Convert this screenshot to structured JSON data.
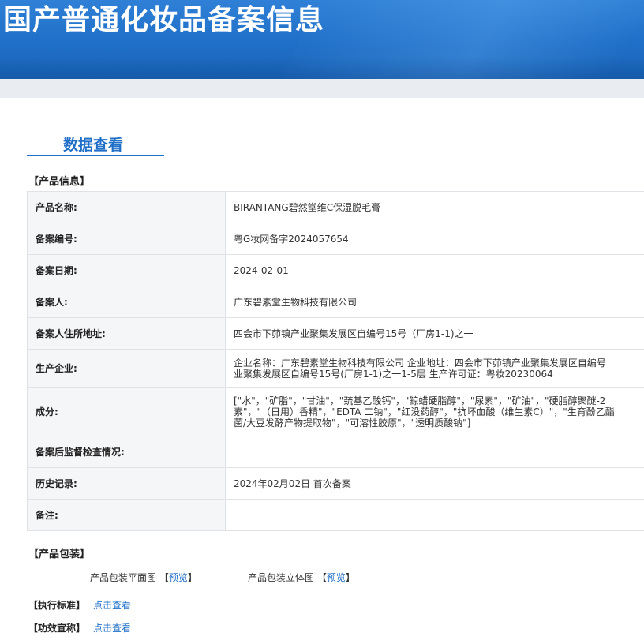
{
  "banner": {
    "title": "国产普通化妆品备案信息"
  },
  "tab": {
    "label": "数据查看"
  },
  "product_info": {
    "heading": "【产品信息】",
    "rows": [
      {
        "label": "产品名称:",
        "value": "BIRANTANG碧然堂维C保湿脱毛膏"
      },
      {
        "label": "备案编号:",
        "value": "粤G妆网备字2024057654"
      },
      {
        "label": "备案日期:",
        "value": "2024-02-01"
      },
      {
        "label": "备案人:",
        "value": "广东碧素堂生物科技有限公司"
      },
      {
        "label": "备案人住所地址:",
        "value": "四会市下茆镇产业聚集发展区自编号15号（厂房1-1)之一"
      },
      {
        "label": "生产企业:",
        "value_lines": [
          "企业名称：广东碧素堂生物科技有限公司 企业地址：四会市下茆镇产业聚集发展区自编号",
          "业聚集发展区自编号15号(厂房1-1)之一1-5层 生产许可证：粤妆20230064"
        ]
      },
      {
        "label": "成分:",
        "value_lines": [
          "[\"水\"，\"矿脂\"，\"甘油\"，\"巯基乙酸钙\"，\"鲸蜡硬脂醇\"，\"尿素\"，\"矿油\"，\"硬脂醇聚醚-2",
          "素\"，\"（日用）香精\"，\"EDTA 二钠\"，\"红没药醇\"，\"抗坏血酸（维生素C）\"，\"生育酚乙酯",
          "菌/大豆发酵产物提取物\"，\"可溶性胶原\"，\"透明质酸钠\"]"
        ]
      },
      {
        "label": "备案后监督检查情况:",
        "value": ""
      },
      {
        "label": "历史记录:",
        "value": "2024年02月02日 首次备案"
      },
      {
        "label": "备注:",
        "value": ""
      }
    ]
  },
  "packaging": {
    "heading": "【产品包装】",
    "flat_label": "产品包装平面图",
    "solid_label": "产品包装立体图",
    "preview_open": "【",
    "preview_text": "预览",
    "preview_close": "】"
  },
  "standard": {
    "heading": "【执行标准】",
    "link": "点击查看"
  },
  "efficacy": {
    "heading": "【功效宣称】",
    "link": "点击查看"
  }
}
